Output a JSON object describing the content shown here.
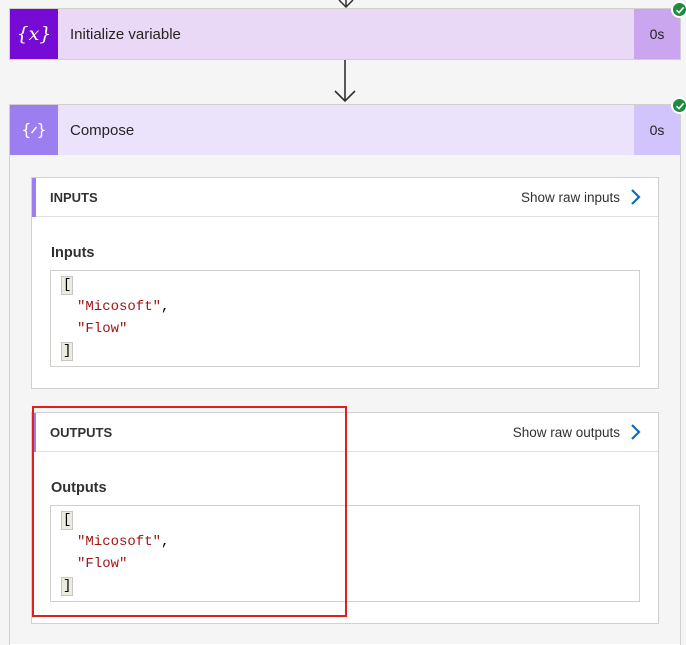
{
  "steps": [
    {
      "title": "Initialize variable",
      "duration": "0s",
      "icon": "variable-icon",
      "status": "succeeded"
    },
    {
      "title": "Compose",
      "duration": "0s",
      "icon": "compose-icon",
      "status": "succeeded"
    }
  ],
  "inputs": {
    "section_title": "INPUTS",
    "raw_link": "Show raw inputs",
    "label": "Inputs",
    "code": {
      "open": "[",
      "items": [
        "\"Micosoft\"",
        "\"Flow\""
      ],
      "close": "]"
    }
  },
  "outputs": {
    "section_title": "OUTPUTS",
    "raw_link": "Show raw outputs",
    "label": "Outputs",
    "code": {
      "open": "[",
      "items": [
        "\"Micosoft\"",
        "\"Flow\""
      ],
      "close": "]"
    }
  },
  "colors": {
    "variable_accent": "#770bd6",
    "compose_accent": "#9b7ef0",
    "success": "#1e8b3e",
    "link_chevron": "#0f6cbd",
    "highlight": "#e02020"
  }
}
